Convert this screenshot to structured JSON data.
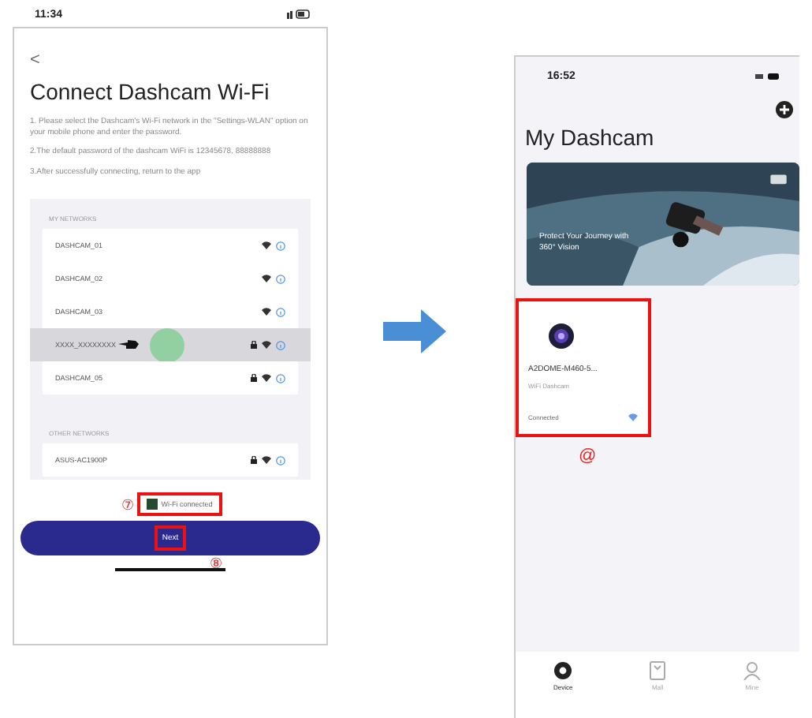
{
  "left_phone": {
    "status_bar": {
      "time": "11:34"
    },
    "back": "<",
    "title": "Connect Dashcam Wi-Fi",
    "instructions": [
      "1. Please select the Dashcam's Wi-Fi network in the \"Settings-WLAN\" option on your mobile phone and enter the password.",
      "2.The default password of the dashcam WiFi is 12345678, 88888888",
      "3.After successfully connecting, return to the app"
    ],
    "network_sections": [
      {
        "heading": "MY NETWORKS",
        "networks": [
          {
            "name": "DASHCAM_01",
            "locked": false,
            "selected": false
          },
          {
            "name": "DASHCAM_02",
            "locked": false,
            "selected": false
          },
          {
            "name": "DASHCAM_03",
            "locked": false,
            "selected": false
          },
          {
            "name": "XXXX_XXXXXXXX",
            "locked": true,
            "selected": true
          },
          {
            "name": "DASHCAM_05",
            "locked": true,
            "selected": false
          }
        ]
      },
      {
        "heading": "OTHER NETWORKS",
        "networks": [
          {
            "name": "ASUS-AC1900P",
            "locked": true,
            "selected": false
          }
        ]
      }
    ],
    "checkbox": {
      "label": "Wi-Fi connected",
      "checked": true,
      "callout": "⑦"
    },
    "next_button": {
      "label": "Next",
      "callout": "⑧"
    }
  },
  "right_phone": {
    "status_bar": {
      "time": "16:52"
    },
    "title": "My Dashcam",
    "banner": {
      "caption": "Protect Your Journey with 360° Vision"
    },
    "device": {
      "name": "A2DOME-M460-5...",
      "type": "WiFi Dashcam",
      "status": "Connected",
      "callout": "@"
    },
    "tabs": [
      {
        "label": "Device",
        "selected": true
      },
      {
        "label": "Mall",
        "selected": false
      },
      {
        "label": "Mine",
        "selected": false
      }
    ]
  }
}
